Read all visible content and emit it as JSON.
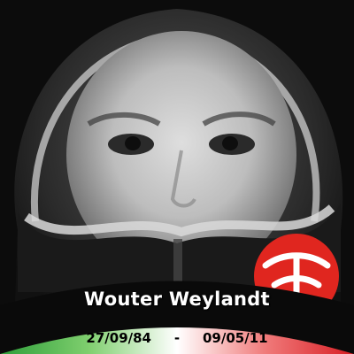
{
  "memorial": {
    "name": "Wouter Weylandt",
    "birth_date": "27/09/84",
    "separator": "-",
    "death_date": "09/05/11"
  },
  "photo": {
    "subject": "portrait-hooded-jacket-grayscale"
  },
  "colors": {
    "flag_green": "#2e9e3a",
    "flag_white": "#ffffff",
    "flag_red": "#d81e24",
    "banner_black": "#0a0a0a",
    "badge_red": "#e0261f"
  }
}
